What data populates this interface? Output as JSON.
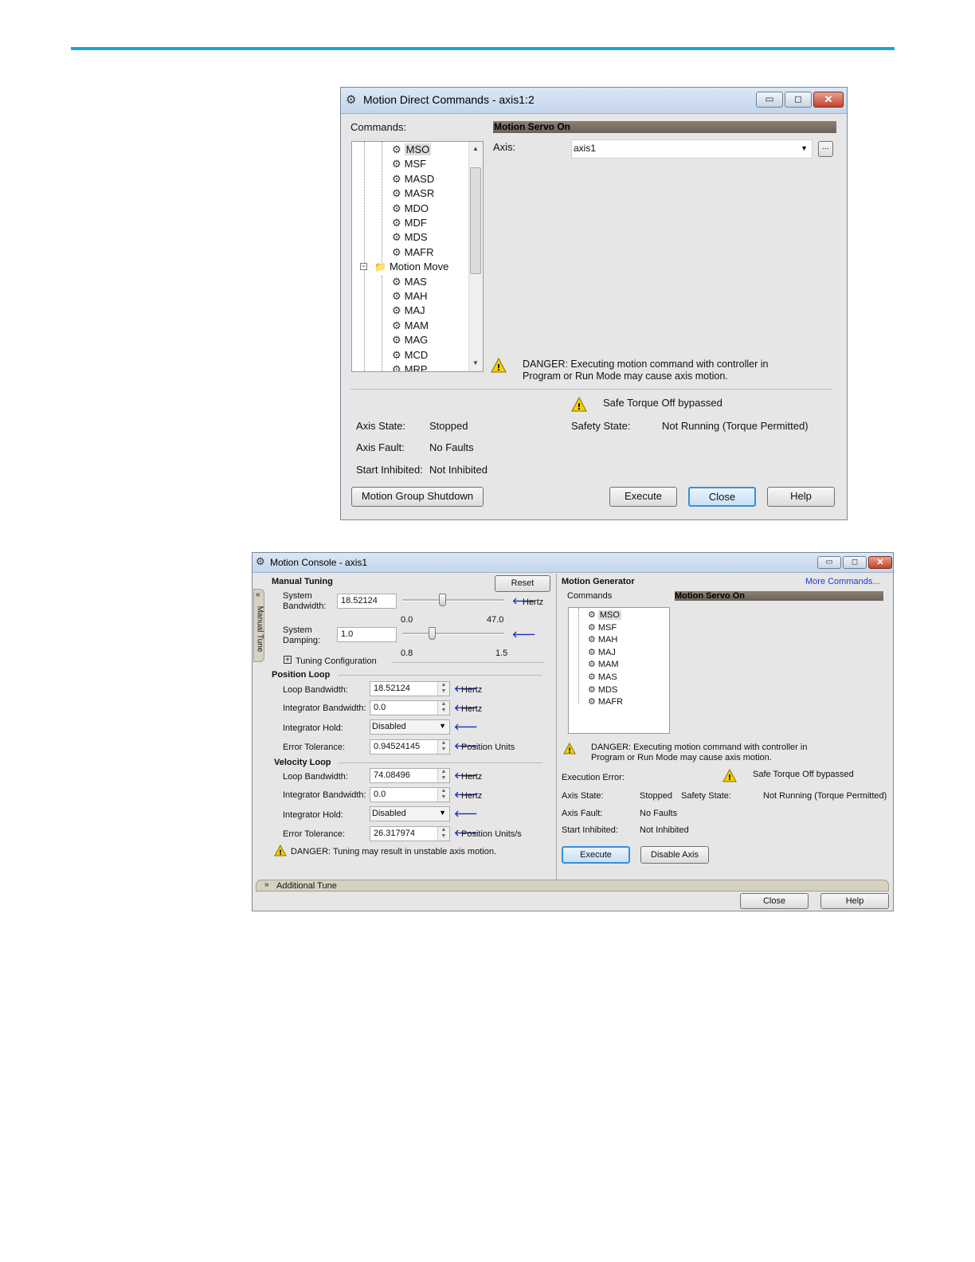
{
  "window1": {
    "title": "Motion Direct Commands - axis1:2",
    "commands_label": "Commands:",
    "header": "Motion Servo On",
    "axis_label": "Axis:",
    "axis_value": "axis1",
    "browse_label": "...",
    "tree": {
      "items_top": [
        "MSO",
        "MSF",
        "MASD",
        "MASR",
        "MDO",
        "MDF",
        "MDS",
        "MAFR"
      ],
      "folder": "Motion Move",
      "items_bottom": [
        "MAS",
        "MAH",
        "MAJ",
        "MAM",
        "MAG",
        "MCD",
        "MRP"
      ]
    },
    "danger_line1": "DANGER: Executing motion command with controller in",
    "danger_line2": "Program or Run Mode may cause axis motion.",
    "sto_text": "Safe Torque Off bypassed",
    "axis_state_label": "Axis State:",
    "axis_state_value": "Stopped",
    "safety_state_label": "Safety State:",
    "safety_state_value": "Not Running (Torque Permitted)",
    "axis_fault_label": "Axis Fault:",
    "axis_fault_value": "No Faults",
    "start_inhibited_label": "Start Inhibited:",
    "start_inhibited_value": "Not Inhibited",
    "buttons": {
      "group_shutdown": "Motion Group Shutdown",
      "execute": "Execute",
      "close": "Close",
      "help": "Help"
    }
  },
  "window2": {
    "title": "Motion Console - axis1",
    "side_tab": "Manual Tune",
    "manual_tuning": {
      "heading": "Manual Tuning",
      "reset": "Reset",
      "sys_bw_label_1": "System",
      "sys_bw_label_2": "Bandwidth:",
      "sys_bw_value": "18.52124",
      "sys_bw_unit": "Hertz",
      "sys_bw_min": "0.0",
      "sys_bw_max": "47.0",
      "sys_bw_fraction": 0.39,
      "sys_damp_label_1": "System",
      "sys_damp_label_2": "Damping:",
      "sys_damp_value": "1.0",
      "sys_damp_min": "0.8",
      "sys_damp_max": "1.5",
      "sys_damp_fraction": 0.29,
      "tuning_config": "Tuning Configuration"
    },
    "position_loop": {
      "heading": "Position Loop",
      "loop_bw_label": "Loop Bandwidth:",
      "loop_bw_value": "18.52124",
      "loop_bw_unit": "Hertz",
      "int_bw_label": "Integrator Bandwidth:",
      "int_bw_value": "0.0",
      "int_bw_unit": "Hertz",
      "int_hold_label": "Integrator Hold:",
      "int_hold_value": "Disabled",
      "err_tol_label": "Error Tolerance:",
      "err_tol_value": "0.94524145",
      "err_tol_unit": "Position Units"
    },
    "velocity_loop": {
      "heading": "Velocity Loop",
      "loop_bw_label": "Loop Bandwidth:",
      "loop_bw_value": "74.08496",
      "loop_bw_unit": "Hertz",
      "int_bw_label": "Integrator Bandwidth:",
      "int_bw_value": "0.0",
      "int_bw_unit": "Hertz",
      "int_hold_label": "Integrator Hold:",
      "int_hold_value": "Disabled",
      "err_tol_label": "Error Tolerance:",
      "err_tol_value": "26.317974",
      "err_tol_unit": "Position Units/s"
    },
    "tuning_danger": "DANGER: Tuning may result in unstable axis motion.",
    "motion_generator": {
      "heading": "Motion Generator",
      "more_commands": "More Commands...",
      "commands_label": "Commands",
      "header": "Motion Servo On",
      "commands": [
        "MSO",
        "MSF",
        "MAH",
        "MAJ",
        "MAM",
        "MAS",
        "MDS",
        "MAFR"
      ],
      "danger_line1": "DANGER: Executing motion command with controller in",
      "danger_line2": "Program or Run Mode may cause axis motion.",
      "execution_error_label": "Execution Error:",
      "sto_text": "Safe Torque Off bypassed",
      "axis_state_label": "Axis State:",
      "axis_state_value": "Stopped",
      "safety_state_label": "Safety State:",
      "safety_state_value": "Not Running (Torque Permitted)",
      "axis_fault_label": "Axis Fault:",
      "axis_fault_value": "No Faults",
      "start_inhibited_label": "Start Inhibited:",
      "start_inhibited_value": "Not Inhibited",
      "execute": "Execute",
      "disable_axis": "Disable Axis"
    },
    "additional_tune": "Additional Tune",
    "close": "Close",
    "help": "Help"
  },
  "colors": {
    "accent_line": "#1ba6dc",
    "header_bar": "#7a7065",
    "link": "#1a3dd6"
  }
}
